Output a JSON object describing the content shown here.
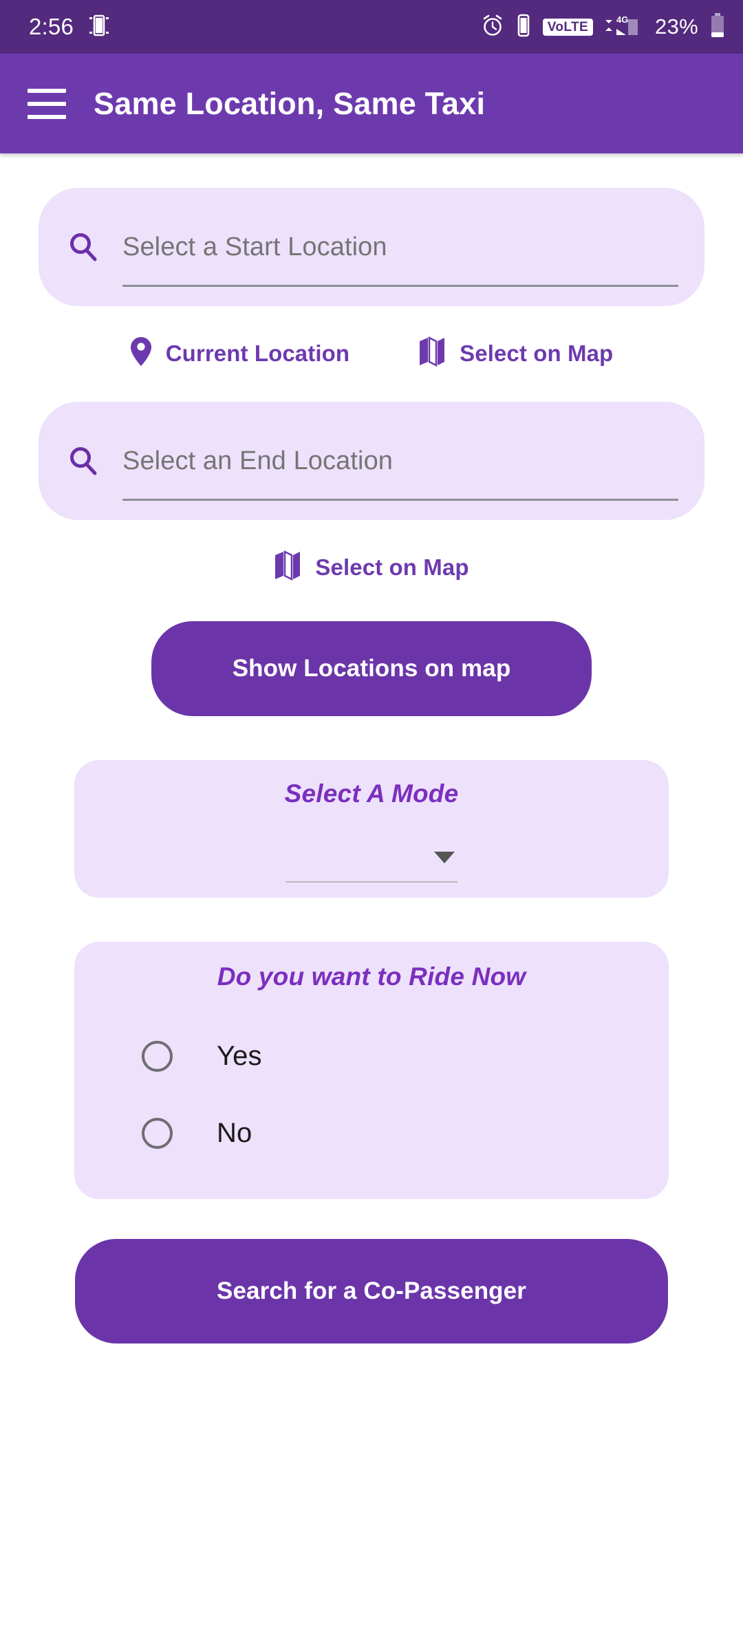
{
  "status_bar": {
    "time": "2:56",
    "battery_percent": "23%",
    "volte_label": "VoLTE",
    "network_label": "4G",
    "icons": [
      "screen-cast-icon",
      "alarm-icon",
      "vibrate-icon",
      "volte-icon",
      "signal-icon",
      "battery-icon"
    ],
    "background_color": "#532A7E"
  },
  "app_bar": {
    "title": "Same Location, Same Taxi",
    "menu_icon": "hamburger-menu-icon",
    "background_color": "#6D3AAE"
  },
  "start_location": {
    "placeholder": "Select a Start Location",
    "icon": "search-icon",
    "actions": [
      {
        "label": "Current Location",
        "icon": "location-pin-icon"
      },
      {
        "label": "Select on Map",
        "icon": "map-icon"
      }
    ]
  },
  "end_location": {
    "placeholder": "Select an End Location",
    "icon": "search-icon",
    "actions": [
      {
        "label": "Select on Map",
        "icon": "map-icon"
      }
    ]
  },
  "show_locations_button": {
    "label": "Show Locations on map"
  },
  "mode_panel": {
    "heading": "Select A Mode",
    "selected_value": "",
    "caret_icon": "chevron-down-icon"
  },
  "ride_now_panel": {
    "heading": "Do you want to Ride Now",
    "options": [
      {
        "label": "Yes",
        "selected": false
      },
      {
        "label": "No",
        "selected": false
      }
    ]
  },
  "search_copassenger_button": {
    "label": "Search for a Co-Passenger"
  },
  "colors": {
    "primary": "#6B35A9",
    "app_bar": "#6D3AAE",
    "status_bar": "#532A7E",
    "card_background": "#EDE1FB",
    "accent_text": "#7B2FBE",
    "page_background": "#FFFFFF"
  }
}
